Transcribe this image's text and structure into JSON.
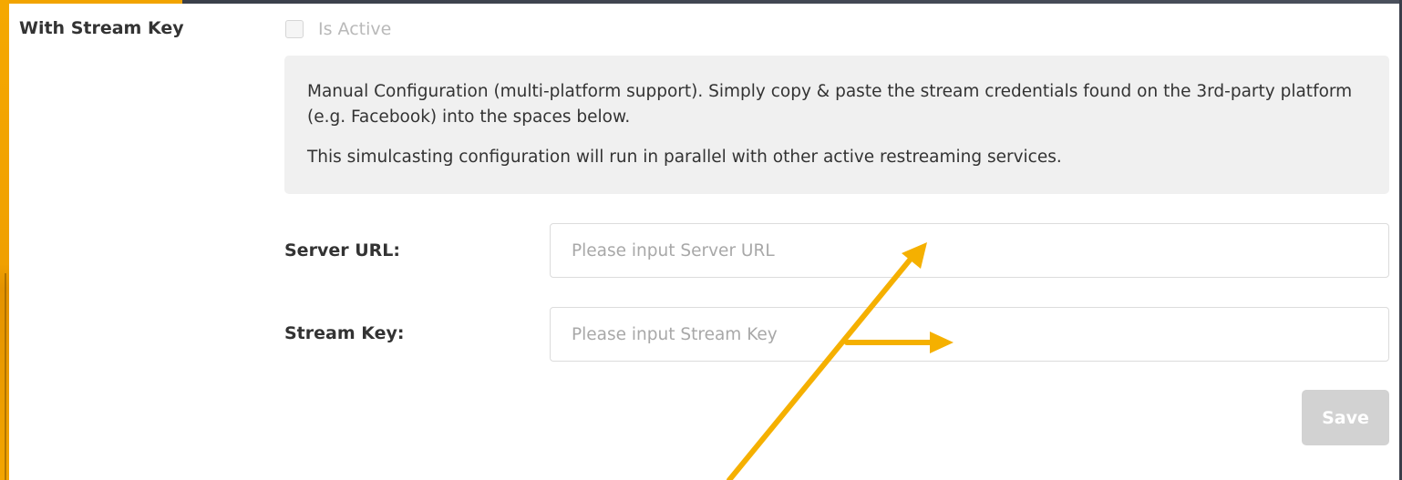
{
  "section": {
    "label": "With Stream Key"
  },
  "active_toggle": {
    "label": "Is Active",
    "checked": false
  },
  "info": {
    "paragraph1": "Manual Configuration (multi-platform support). Simply copy & paste the stream credentials found on the 3rd-party platform (e.g. Facebook) into the spaces below.",
    "paragraph2": "This simulcasting configuration will run in parallel with other active restreaming services."
  },
  "fields": {
    "server_url": {
      "label": "Server URL:",
      "value": "",
      "placeholder": "Please input Server URL"
    },
    "stream_key": {
      "label": "Stream Key:",
      "value": "",
      "placeholder": "Please input Stream Key"
    }
  },
  "actions": {
    "save_label": "Save"
  },
  "colors": {
    "accent": "#f5b000",
    "info_bg": "#f0f0f0",
    "button_disabled": "#d2d2d2"
  }
}
